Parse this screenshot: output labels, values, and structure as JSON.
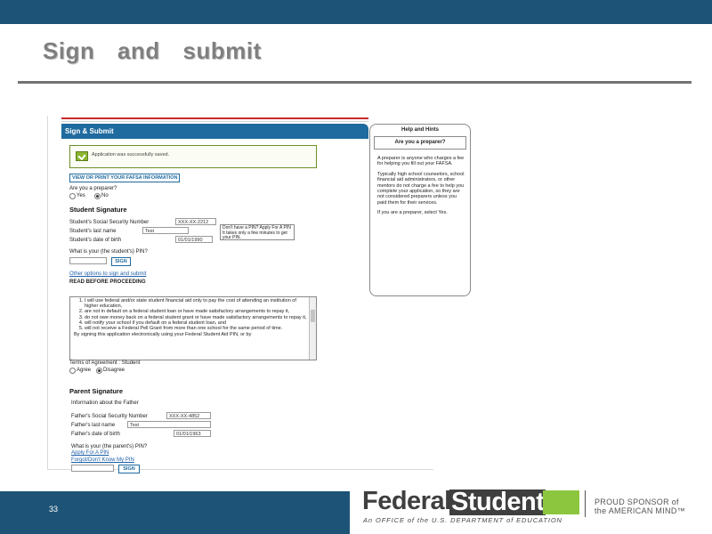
{
  "slide": {
    "title": "Sign  and  submit",
    "page_number": "33"
  },
  "form": {
    "header": "Sign & Submit",
    "success_message": "Application was successfully saved.",
    "view_print_link": "VIEW OR PRINT YOUR FAFSA INFORMATION",
    "preparer_question": "Are you a preparer?",
    "preparer_yes": "Yes",
    "preparer_no": "No",
    "student_signature_heading": "Student Signature",
    "ssn_label": "Student's Social Security Number",
    "ssn_value": "XXX-XX-2212",
    "last_name_label": "Student's last name",
    "last_name_value": "Test",
    "dob_label": "Student's date of birth",
    "dob_value": "01/01/1990",
    "pin_note": "Don't have a PIN? Apply For A PIN It takes only a few minutes to get your PIN.",
    "pin_question": "What is your (the student's) PIN?",
    "sign_label": "SIGN",
    "other_options_link": "Other options to sign and submit",
    "read_before": "READ BEFORE PROCEEDING",
    "agreement_items": [
      "I will use federal and/or state student financial aid only to pay the cost of attending an institution of higher education,",
      "are not in default on a federal student loan or have made satisfactory arrangements to repay it,",
      "do not owe money back on a federal student grant or have made satisfactory arrangements to repay it,",
      "will notify your school if you default on a federal student loan, and",
      "will not receive a Federal Pell Grant from more than one school for the same period of time."
    ],
    "agreement_footer": "By signing this application electronically using your Federal Student Aid PIN, or by",
    "terms_label": "Terms of Agreement : Student",
    "agree": "Agree",
    "disagree": "Disagree",
    "parent_signature_heading": "Parent Signature",
    "father_info": "Information about the Father",
    "father_ssn_label": "Father's Social Security Number",
    "father_ssn_value": "XXX-XX-4852",
    "father_last_name_label": "Father's last name",
    "father_last_name_value": "Test",
    "father_dob_label": "Father's date of birth",
    "father_dob_value": "01/01/1963",
    "parent_pin_question": "What is your (the parent's) PIN?",
    "apply_pin_link": "Apply For A PIN",
    "forgot_pin_link": "Forgot/Don't Know My PIN",
    "parent_sign_label": "SIGN"
  },
  "help": {
    "title": "Help and Hints",
    "subtitle": "Are you a preparer?",
    "paragraphs": [
      "A preparer is anyone who charges a fee for helping you fill out your FAFSA.",
      "Typically high school counselors, school financial aid administrators, or other mentors do not charge a fee to help you complete your application, so they are not considered preparers unless you paid them for their services.",
      "If you are a preparer, select Yes."
    ]
  },
  "footer": {
    "logo_federal": "Federal",
    "logo_student": "Student",
    "logo_sub": "An OFFICE of the U.S. DEPARTMENT of EDUCATION",
    "proud_line1": "PROUD SPONSOR of",
    "proud_line2": "the AMERICAN MIND™"
  },
  "colors": {
    "brand_blue": "#1d5377",
    "form_header": "#1f6a9e",
    "accent_green": "#8cc63f"
  }
}
